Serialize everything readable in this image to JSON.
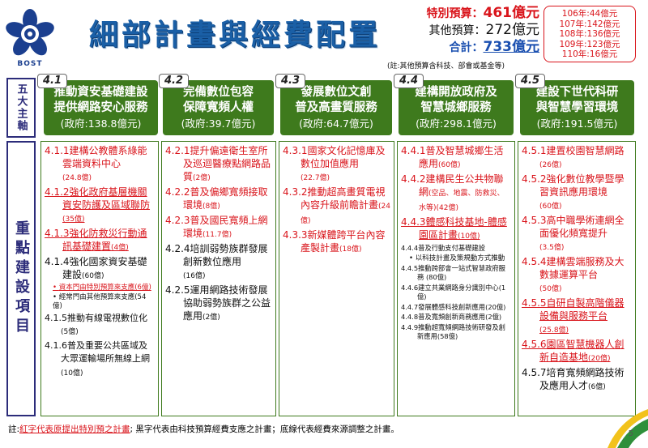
{
  "logo": {
    "text": "BOST"
  },
  "title": "細部計畫與經費配置",
  "budget": {
    "special_label": "特別預算：",
    "special_amount": "461億元",
    "other_label": "其他預算：",
    "other_amount": "272億元",
    "total_label": "合計：",
    "total_amount": "733億元",
    "note": "(註:其他預算含科技、部會或基金等)"
  },
  "years": [
    "106年:44億元",
    "107年:142億元",
    "108年:136億元",
    "109年:123億元",
    "110年:16億元"
  ],
  "side": {
    "axes_label": "五大主軸",
    "items_label": "重點建設項目"
  },
  "axes": [
    {
      "num": "4.1",
      "title1": "推動資安基礎建設",
      "title2": "提供網路安心服務",
      "gov": "(政府:138.8億元)"
    },
    {
      "num": "4.2",
      "title1": "完備數位包容",
      "title2": "保障寬頻人權",
      "gov": "(政府:39.7億元)"
    },
    {
      "num": "4.3",
      "title1": "發展數位文創",
      "title2": "普及高畫質服務",
      "gov": "(政府:64.7億元)"
    },
    {
      "num": "4.4",
      "title1": "建構開放政府及",
      "title2": "智慧城鄉服務",
      "gov": "(政府:298.1億元)"
    },
    {
      "num": "4.5",
      "title1": "建設下世代科研",
      "title2": "與智慧學習環境",
      "gov": "(政府:191.5億元)"
    }
  ],
  "col1": {
    "i1": "4.1.1建構公教體系綠能雲端資料中心",
    "i1v": "(24.8億)",
    "i2": "4.1.2強化政府基層機關資安防護及區域聯防",
    "i2v": "(35億)",
    "i3": "4.1.3強化防救災行動通訊基礎建置",
    "i3v": "(4億)",
    "i4": "4.1.4強化國家資安基礎建設",
    "i4v": "(60億)",
    "b1": "資本門由特別預算來支應(6億)",
    "b2": "經常門由其他預算來支應(54億)",
    "i5": "4.1.5推動有線電視數位化",
    "i5v": "(5億)",
    "i6": "4.1.6普及重要公共區域及大眾運輸場所無線上網",
    "i6v": " (10億)"
  },
  "col2": {
    "i1": "4.2.1提升偏遠衛生室所及巡迴醫療點網路品質",
    "i1v": "(2億)",
    "i2": "4.2.2普及偏鄉寬頻接取環境",
    "i2v": "(8億)",
    "i3": "4.2.3普及國民寬頻上網環境",
    "i3v": "(11.7億)",
    "i4": "4.2.4培訓弱勢族群發展創新數位應用",
    "i4v": "(16億)",
    "i5": "4.2.5運用網路技術發展協助弱勢族群之公益應用",
    "i5v": "(2億)"
  },
  "col3": {
    "i1": "4.3.1國家文化記憶庫及數位加值應用",
    "i1v": "(22.7億)",
    "i2": "4.3.2推動超高畫質電視內容升級前瞻計畫",
    "i2v": "(24億)",
    "i3": "4.3.3新媒體跨平台內容產製計畫",
    "i3v": "(18億)"
  },
  "col4": {
    "i1": "4.4.1普及智慧城鄉生活應用",
    "i1v": "(60億)",
    "i2": "4.4.2建構民生公共物聯網",
    "i2v": "(空品、地震、防救災、水等)(42億)",
    "i3": "4.4.3體感科技基地-體感園區計畫",
    "i3v": "(10億)",
    "i4": "4.4.4普及行動支付基礎建設",
    "b1": "以科技計畫及策規動方式推動",
    "i5": "4.4.5推動跨部會一站式智慧政府服務",
    "i5v": " (80億)",
    "i6": "4.4.6建立共業網路身分識別中心",
    "i6v": "(1億)",
    "i7": "4.4.7發展體感科技創新應用",
    "i7v": "(20億)",
    "i8": "4.4.8普及寬頻創新商務應用",
    "i8v": "(2億)",
    "i9": "4.4.9推動超寬頻網路技術研發及創新應用",
    "i9v": "(58億)"
  },
  "col5": {
    "i1": "4.5.1建置校園智慧網路",
    "i1v": "(26億)",
    "i2": "4.5.2強化數位教學暨學習資訊應用環境",
    "i2v": "(60億)",
    "i3": "4.5.3高中職學術連網全面優化頻寬提升",
    "i3v": "(3.5億)",
    "i4": "4.5.4建構雲端服務及大數據運算平台",
    "i4v": "(50億)",
    "i5": "4.5.5自研自製高階儀器設備與服務平台",
    "i5v": "(25.8億)",
    "i6": "4.5.6園區智慧機器人創新自造基地",
    "i6v": "(20億)",
    "i7": "4.5.7培育寬頻網路技術及應用人才",
    "i7v": "(6億)"
  },
  "footer": {
    "prefix": "註:",
    "red": "紅字代表原提出特別預之計畫",
    "rest": "; 黑字代表由科技預算經費支應之計畫；底線代表經費來源調整之計畫。"
  },
  "page_number": "5",
  "colors": {
    "red": "#d9141b",
    "green": "#3e7a1d",
    "blue": "#1a5fa6"
  }
}
